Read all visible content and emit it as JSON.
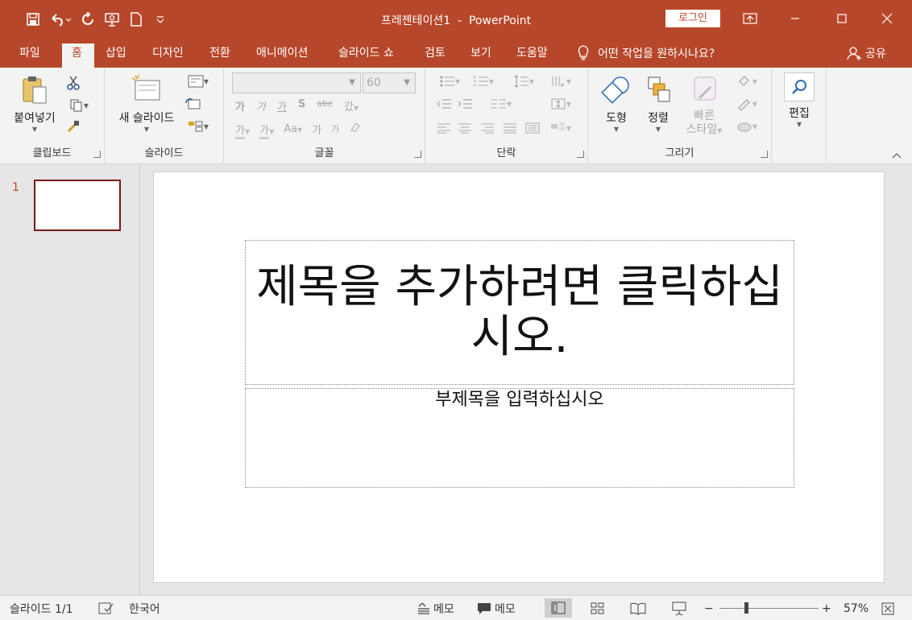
{
  "title": {
    "doc_name": "프레젠테이션1",
    "separator": "-",
    "app_name": "PowerPoint",
    "login": "로그인"
  },
  "colors": {
    "accent": "#b7472a",
    "ribbon_bg": "#f3f3f3",
    "workspace_bg": "#e6e6e6",
    "thumb_border": "#7a1a1a"
  },
  "tabs": [
    {
      "label": "파일"
    },
    {
      "label": "홈"
    },
    {
      "label": "삽입"
    },
    {
      "label": "디자인"
    },
    {
      "label": "전환"
    },
    {
      "label": "애니메이션"
    },
    {
      "label": "슬라이드 쇼"
    },
    {
      "label": "검토"
    },
    {
      "label": "보기"
    },
    {
      "label": "도움말"
    }
  ],
  "active_tab": "홈",
  "tell_me": "어떤 작업을 원하시나요?",
  "share": "공유",
  "ribbon": {
    "clipboard": {
      "label": "클립보드",
      "paste": "붙여넣기"
    },
    "slides": {
      "label": "슬라이드",
      "new_slide": "새 슬라이드"
    },
    "font": {
      "label": "글꼴",
      "size": "60",
      "ga1": "가",
      "ga2": "가",
      "ga3": "가",
      "s": "S",
      "abc": "abc",
      "ga_spacing": "갔",
      "ga_highlight": "가",
      "ga_color": "가",
      "aa": "Aa",
      "ga_grow": "가",
      "ga_shrink": "가"
    },
    "paragraph": {
      "label": "단락"
    },
    "drawing": {
      "label": "그리기",
      "shapes": "도형",
      "arrange": "정렬",
      "quick_styles_1": "빠른",
      "quick_styles_2": "스타일"
    },
    "editing": {
      "label": "편집"
    }
  },
  "thumbnails": [
    {
      "number": "1"
    }
  ],
  "slide": {
    "title_placeholder": "제목을 추가하려면 클릭하십시오.",
    "subtitle_placeholder": "부제목을 입력하십시오"
  },
  "status": {
    "slide_counter": "슬라이드 1/1",
    "language": "한국어",
    "notes": "메모",
    "comments": "메모",
    "zoom": "57%",
    "zoom_minus": "−",
    "zoom_plus": "+"
  }
}
